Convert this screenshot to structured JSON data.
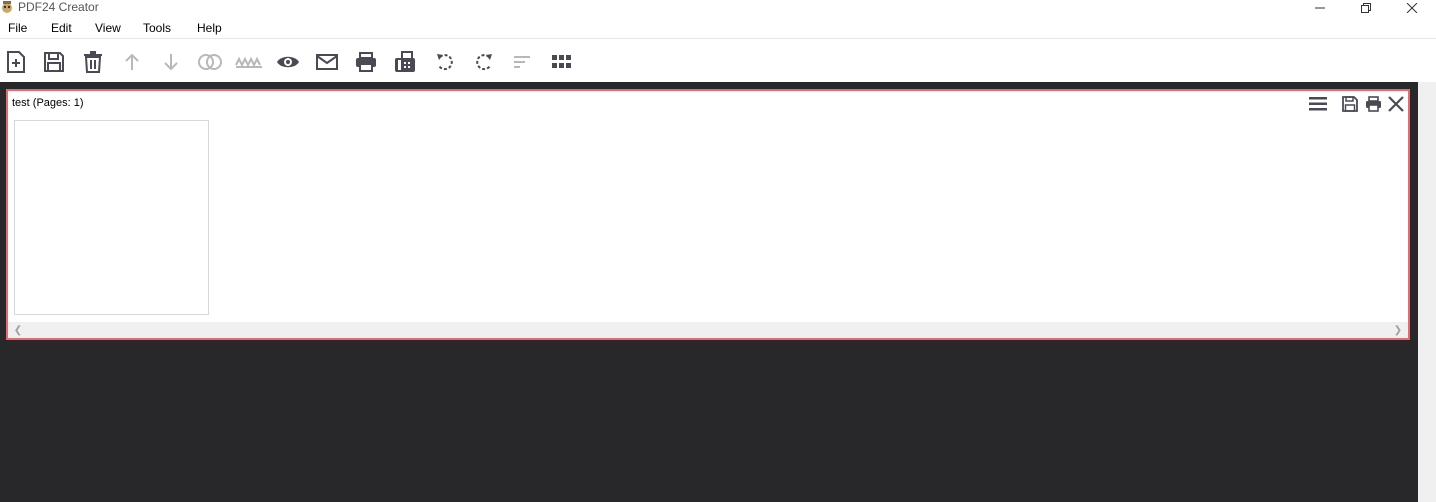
{
  "window": {
    "title": "PDF24 Creator",
    "controls": [
      "minimize-icon",
      "restore-icon",
      "close-icon"
    ]
  },
  "menu": {
    "items": [
      {
        "label": "File"
      },
      {
        "label": "Edit"
      },
      {
        "label": "View"
      },
      {
        "label": "Tools"
      },
      {
        "label": "Help"
      }
    ]
  },
  "toolbar": {
    "buttons": [
      {
        "icon": "new-document-icon",
        "enabled": true
      },
      {
        "icon": "save-icon",
        "enabled": true
      },
      {
        "icon": "trash-icon",
        "enabled": true
      },
      {
        "icon": "arrow-up-icon",
        "enabled": false
      },
      {
        "icon": "arrow-down-icon",
        "enabled": false
      },
      {
        "icon": "merge-icon",
        "enabled": false
      },
      {
        "icon": "split-icon",
        "enabled": false
      },
      {
        "icon": "preview-eye-icon",
        "enabled": true
      },
      {
        "icon": "email-icon",
        "enabled": true
      },
      {
        "icon": "print-icon",
        "enabled": true
      },
      {
        "icon": "fax-icon",
        "enabled": true
      },
      {
        "icon": "rotate-left-icon",
        "enabled": true
      },
      {
        "icon": "rotate-right-icon",
        "enabled": true
      },
      {
        "icon": "sort-icon",
        "enabled": false
      },
      {
        "icon": "grid-view-icon",
        "enabled": true
      }
    ]
  },
  "document": {
    "title": "test (Pages: 1)",
    "actions": [
      "menu-icon",
      "save-icon",
      "print-icon",
      "close-icon"
    ],
    "accent_color": "#e36b72"
  },
  "colors": {
    "workspace_bg": "#28272a",
    "icon_dark": "#4a4a55",
    "icon_disabled": "#b8b8b8"
  }
}
